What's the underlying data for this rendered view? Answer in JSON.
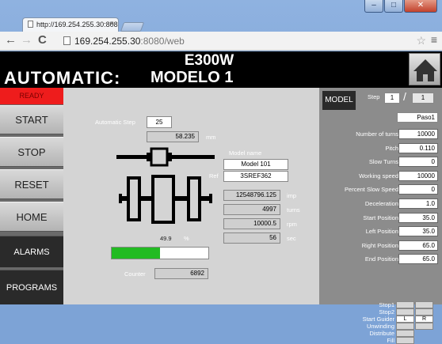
{
  "browser": {
    "tab_title": "http://169.254.255.30:808",
    "address_host": "169.254.255.30",
    "address_rest": ":8080/web"
  },
  "banner": {
    "model_code": "E300W",
    "mode": "AUTOMATIC:",
    "model_label": "MODELO 1"
  },
  "sidebar": {
    "status": "READY",
    "buttons": [
      "START",
      "STOP",
      "RESET",
      "HOME"
    ],
    "dark_buttons": [
      "ALARMS",
      "PROGRAMS"
    ]
  },
  "center": {
    "automatic_step_label": "Automatic Step",
    "automatic_step_value": "25",
    "position_value": "58.235",
    "position_unit": "mm",
    "model_name_label": "Model name",
    "model_name_value": "Model 101",
    "ref_label": "Ref",
    "ref_value": "3SREF362",
    "imp_value": "12548796.125",
    "imp_unit": "imp",
    "turns_value": "4997",
    "turns_unit": "turns",
    "rpm_value": "10000.5",
    "rpm_unit": "rpm",
    "sec_value": "56",
    "sec_unit": "sec",
    "progress_value": "49.9",
    "progress_unit": "%",
    "progress_fraction": 0.499,
    "counter_label": "Counter",
    "counter_value": "6892"
  },
  "right_panel": {
    "model_button": "MODEL",
    "step_label": "Step",
    "step_value": "1",
    "step_separator": "/",
    "step_total": "1",
    "step_name": "Paso1",
    "params": [
      {
        "label": "Number of turns",
        "value": "10000"
      },
      {
        "label": "Pitch",
        "value": "0.110"
      },
      {
        "label": "Slow Turns",
        "value": "0"
      },
      {
        "label": "Working speed",
        "value": "10000"
      },
      {
        "label": "Percent Slow Speed",
        "value": "0"
      },
      {
        "label": "Deceleration",
        "value": "1.0"
      },
      {
        "label": "Start Position",
        "value": "35.0"
      },
      {
        "label": "Left Position",
        "value": "35.0"
      },
      {
        "label": "Right Position",
        "value": "65.0"
      },
      {
        "label": "End Position",
        "value": "65.0"
      }
    ],
    "signals": [
      "Stop1",
      "Stop2",
      "Start Guider",
      "Unwinding",
      "Distribute",
      "Fill"
    ],
    "guider_left": "L",
    "guider_right": "R"
  },
  "colors": {
    "ready_red": "#ee1c1c",
    "progress_green": "#22bb22",
    "banner_black": "#000000"
  }
}
